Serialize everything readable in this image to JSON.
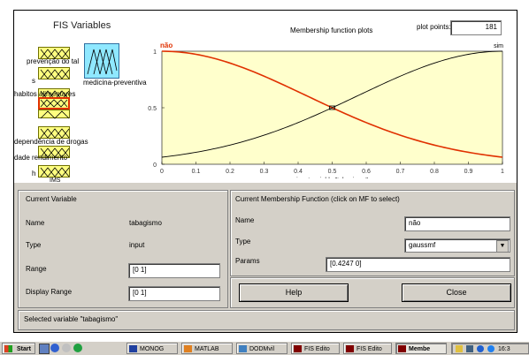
{
  "fis_panel": {
    "title": "FIS Variables"
  },
  "input_variables": [
    {
      "label": "prevenção do tal"
    },
    {
      "label": "s"
    },
    {
      "label": "habitos alimentares"
    },
    {
      "label": ""
    },
    {
      "label": "dependência de drogas"
    },
    {
      "label": "dade rendimento"
    },
    {
      "label": "h"
    }
  ],
  "output_variable": {
    "label": "medicina-preventiva"
  },
  "ims_label": "IMS",
  "plot": {
    "title": "Membership function plots",
    "points_label": "plot points:",
    "points_value": "181",
    "xlabel": "input variable \"tabagismo\"",
    "mf_left_label": "não",
    "mf_right_label": "sim",
    "accent_left": "#e03000",
    "accent_right": "#000000",
    "background": "#ffffcc"
  },
  "chart_data": {
    "type": "line",
    "title": "Membership function plots",
    "xlabel": "input variable \"tabagismo\"",
    "ylabel": "",
    "xlim": [
      0,
      1
    ],
    "ylim": [
      0,
      1
    ],
    "xticks": [
      "0",
      "0.1",
      "0.2",
      "0.3",
      "0.4",
      "0.5",
      "0.6",
      "0.7",
      "0.8",
      "0.9",
      "1"
    ],
    "yticks": [
      "0",
      "0.5",
      "1"
    ],
    "series": [
      {
        "name": "não",
        "color": "#e03000",
        "x": [
          0,
          0.1,
          0.2,
          0.3,
          0.4,
          0.5,
          0.6,
          0.7,
          0.8,
          0.9,
          1
        ],
        "y": [
          1,
          0.973,
          0.895,
          0.779,
          0.642,
          0.5,
          0.37,
          0.257,
          0.169,
          0.106,
          0.062
        ]
      },
      {
        "name": "sim",
        "color": "#000000",
        "x": [
          0,
          0.1,
          0.2,
          0.3,
          0.4,
          0.5,
          0.6,
          0.7,
          0.8,
          0.9,
          1
        ],
        "y": [
          0.062,
          0.106,
          0.169,
          0.257,
          0.37,
          0.5,
          0.642,
          0.779,
          0.895,
          0.973,
          1
        ]
      }
    ]
  },
  "current_variable": {
    "header": "Current Variable",
    "name_label": "Name",
    "name_value": "tabagismo",
    "type_label": "Type",
    "type_value": "input",
    "range_label": "Range",
    "range_value": "[0 1]",
    "display_range_label": "Display Range",
    "display_range_value": "[0 1]"
  },
  "current_mf": {
    "header": "Current Membership Function (click on MF to select)",
    "name_label": "Name",
    "name_value": "não",
    "type_label": "Type",
    "type_value": "gaussmf",
    "params_label": "Params",
    "params_value": "[0.4247 0]"
  },
  "buttons": {
    "help": "Help",
    "close": "Close"
  },
  "status": "Selected variable \"tabagismo\"",
  "taskbar": {
    "start": "Start",
    "items": [
      "MONOG",
      "MATLAB",
      "DODMvil",
      "FIS Edito",
      "FIS Edito",
      "Membe"
    ],
    "clock": "16:3"
  }
}
